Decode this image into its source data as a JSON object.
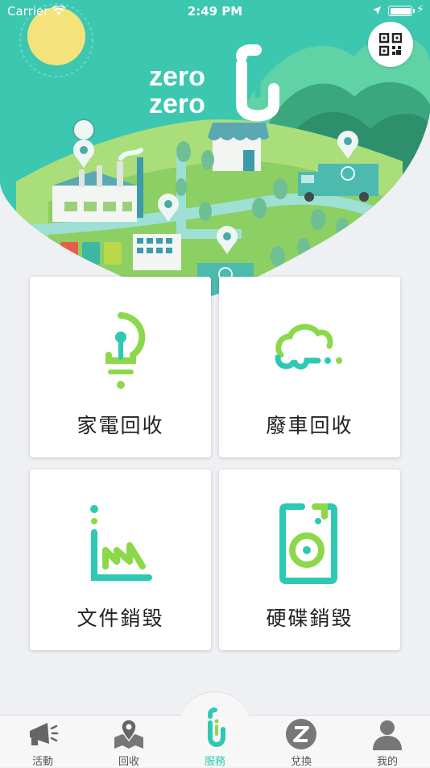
{
  "status_bar": {
    "carrier": "Carrier",
    "time": "2:49 PM",
    "icons": [
      "wifi-icon",
      "location-icon",
      "battery-icon",
      "charging-icon"
    ],
    "battery_level": 1.0
  },
  "hero": {
    "logo_line1": "zero",
    "logo_line2": "zero",
    "qr_icon": "qr-code-icon"
  },
  "services": [
    {
      "label": "家電回收",
      "icon": "light-bulb-icon"
    },
    {
      "label": "廢車回收",
      "icon": "car-icon"
    },
    {
      "label": "文件銷毀",
      "icon": "document-shred-icon"
    },
    {
      "label": "硬碟銷毀",
      "icon": "hard-disk-icon"
    }
  ],
  "tab_bar": {
    "items": [
      {
        "label": "活動",
        "icon": "megaphone-icon"
      },
      {
        "label": "回收",
        "icon": "map-pin-icon"
      },
      {
        "label": "服務",
        "icon": "zero-logo-icon",
        "active": true
      },
      {
        "label": "兌換",
        "icon": "z-coin-icon"
      },
      {
        "label": "我的",
        "icon": "person-icon"
      }
    ]
  },
  "colors": {
    "accent": "#2dc9b3",
    "lime": "#8bd94a",
    "hero_teal": "#3cc7b0",
    "background": "#eef0f3"
  }
}
